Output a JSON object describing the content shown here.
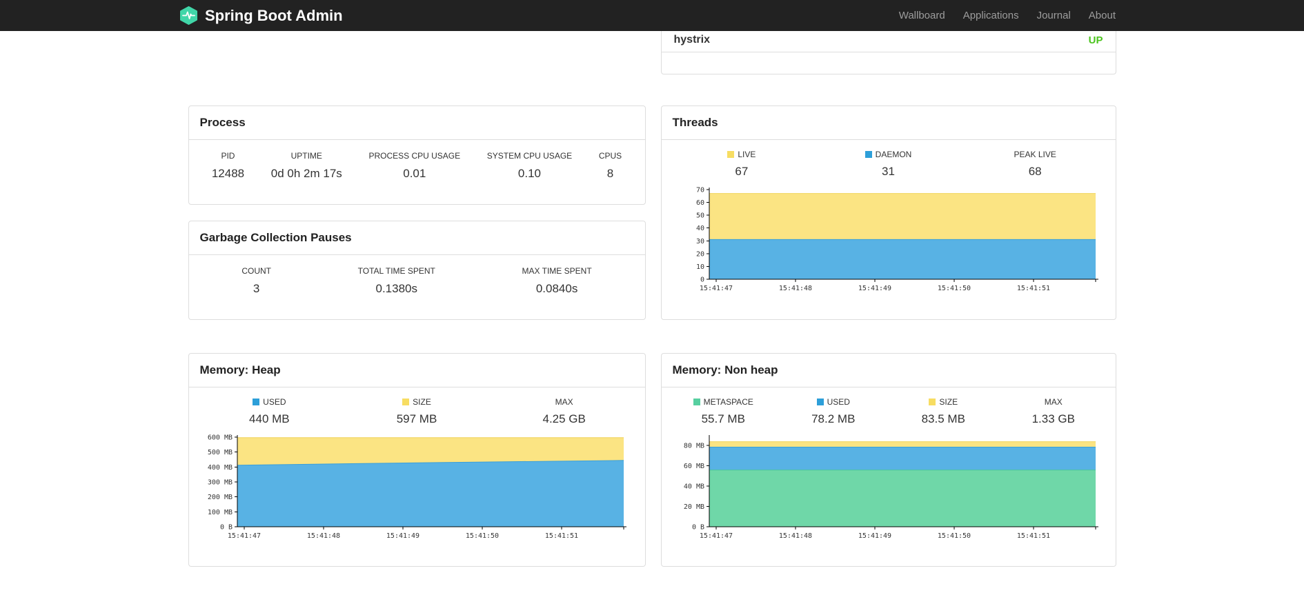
{
  "navbar": {
    "brand": "Spring Boot Admin",
    "brand_color": "#41d6a8",
    "links": [
      {
        "label": "Wallboard"
      },
      {
        "label": "Applications"
      },
      {
        "label": "Journal"
      },
      {
        "label": "About"
      }
    ]
  },
  "application_panel": {
    "name": "hystrix",
    "status": "UP",
    "status_color": "#4ac41c"
  },
  "process": {
    "title": "Process",
    "metrics": [
      {
        "label": "PID",
        "value": "12488"
      },
      {
        "label": "UPTIME",
        "value": "0d 0h 2m 17s"
      },
      {
        "label": "PROCESS CPU USAGE",
        "value": "0.01"
      },
      {
        "label": "SYSTEM CPU USAGE",
        "value": "0.10"
      },
      {
        "label": "CPUS",
        "value": "8"
      }
    ]
  },
  "gc": {
    "title": "Garbage Collection Pauses",
    "metrics": [
      {
        "label": "COUNT",
        "value": "3"
      },
      {
        "label": "TOTAL TIME SPENT",
        "value": "0.1380s"
      },
      {
        "label": "MAX TIME SPENT",
        "value": "0.0840s"
      }
    ]
  },
  "threads": {
    "title": "Threads",
    "legend": [
      {
        "label": "LIVE",
        "value": "67",
        "color": "#f7dd62"
      },
      {
        "label": "DAEMON",
        "value": "31",
        "color": "#2d9fd9"
      },
      {
        "label": "PEAK LIVE",
        "value": "68",
        "color": null
      }
    ]
  },
  "memory_heap": {
    "title": "Memory: Heap",
    "legend": [
      {
        "label": "USED",
        "value": "440 MB",
        "color": "#2d9fd9"
      },
      {
        "label": "SIZE",
        "value": "597 MB",
        "color": "#f7dd62"
      },
      {
        "label": "MAX",
        "value": "4.25 GB",
        "color": null
      }
    ]
  },
  "memory_nonheap": {
    "title": "Memory: Non heap",
    "legend": [
      {
        "label": "METASPACE",
        "value": "55.7 MB",
        "color": "#57cfa0"
      },
      {
        "label": "USED",
        "value": "78.2 MB",
        "color": "#2d9fd9"
      },
      {
        "label": "SIZE",
        "value": "83.5 MB",
        "color": "#f7dd62"
      },
      {
        "label": "MAX",
        "value": "1.33 GB",
        "color": null
      }
    ]
  },
  "chart_data": [
    {
      "id": "threads",
      "type": "area",
      "title": "Threads",
      "x_tick_labels": [
        "15:41:47",
        "15:41:48",
        "15:41:49",
        "15:41:50",
        "15:41:51"
      ],
      "ylim": [
        0,
        70
      ],
      "y_ticks": [
        0,
        10,
        20,
        30,
        40,
        50,
        60,
        70
      ],
      "y_tick_labels": [
        "0",
        "10",
        "20",
        "30",
        "40",
        "50",
        "60",
        "70"
      ],
      "grid": false,
      "series": [
        {
          "name": "LIVE",
          "color": "#fbe483",
          "line_color": "#f0d45c",
          "values": [
            67,
            67,
            67,
            67,
            67,
            67
          ]
        },
        {
          "name": "DAEMON",
          "color": "#58b2e4",
          "line_color": "#3a9fd9",
          "values": [
            31,
            31,
            31,
            31,
            31,
            31
          ]
        }
      ]
    },
    {
      "id": "heap",
      "type": "area",
      "title": "Memory: Heap",
      "x_tick_labels": [
        "15:41:47",
        "15:41:48",
        "15:41:49",
        "15:41:50",
        "15:41:51"
      ],
      "ylim": [
        0,
        600
      ],
      "y_ticks": [
        0,
        100,
        200,
        300,
        400,
        500,
        600
      ],
      "y_tick_labels": [
        "0 B",
        "100 MB",
        "200 MB",
        "300 MB",
        "400 MB",
        "500 MB",
        "600 MB"
      ],
      "grid": false,
      "series": [
        {
          "name": "SIZE",
          "color": "#fbe483",
          "line_color": "#f0d45c",
          "values": [
            597,
            597,
            597,
            597,
            597,
            597
          ]
        },
        {
          "name": "USED",
          "color": "#58b2e4",
          "line_color": "#3a9fd9",
          "values": [
            412,
            419,
            426,
            432,
            438,
            444
          ]
        }
      ]
    },
    {
      "id": "nonheap",
      "type": "area",
      "title": "Memory: Non heap",
      "x_tick_labels": [
        "15:41:47",
        "15:41:48",
        "15:41:49",
        "15:41:50",
        "15:41:51"
      ],
      "ylim": [
        0,
        88
      ],
      "y_ticks": [
        0,
        20,
        40,
        60,
        80
      ],
      "y_tick_labels": [
        "0 B",
        "20 MB",
        "40 MB",
        "60 MB",
        "80 MB"
      ],
      "grid": false,
      "series": [
        {
          "name": "SIZE",
          "color": "#fbe483",
          "line_color": "#f0d45c",
          "values": [
            83.5,
            83.5,
            83.5,
            83.5,
            83.5,
            83.5
          ]
        },
        {
          "name": "USED",
          "color": "#58b2e4",
          "line_color": "#3a9fd9",
          "values": [
            78.2,
            78.2,
            78.2,
            78.2,
            78.2,
            78.2
          ]
        },
        {
          "name": "METASPACE",
          "color": "#6fd7a8",
          "line_color": "#4cc898",
          "values": [
            55.7,
            55.7,
            55.7,
            55.7,
            55.7,
            55.7
          ]
        }
      ]
    }
  ]
}
